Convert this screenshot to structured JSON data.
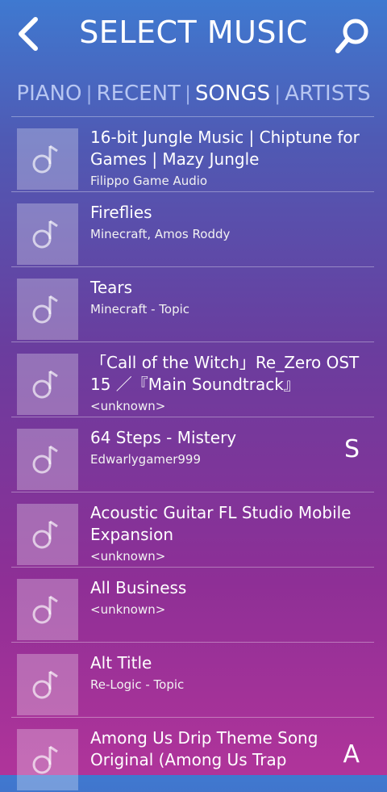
{
  "header": {
    "title": "SELECT MUSIC",
    "back_icon": "back-arrow-icon",
    "search_icon": "search-icon"
  },
  "tabs": [
    {
      "label": "PIANO",
      "active": false
    },
    {
      "label": "RECENT",
      "active": false
    },
    {
      "label": "SONGS",
      "active": true
    },
    {
      "label": "ARTISTS",
      "active": false
    }
  ],
  "songs": [
    {
      "title": "16-bit Jungle Music | Chiptune for Games | Mazy Jungle",
      "artist": "Filippo Game Audio"
    },
    {
      "title": "Fireflies",
      "artist": "Minecraft, Amos Roddy"
    },
    {
      "title": "Tears",
      "artist": "Minecraft - Topic"
    },
    {
      "title": "「Call of the Witch」Re_Zero OST 15 ／『Main Soundtrack』",
      "artist": "<unknown>"
    },
    {
      "title": "64 Steps - Mistery",
      "artist": "Edwarlygamer999"
    },
    {
      "title": "Acoustic Guitar FL Studio Mobile Expansion",
      "artist": "<unknown>"
    },
    {
      "title": "All Business",
      "artist": "<unknown>"
    },
    {
      "title": "Alt Title",
      "artist": "Re-Logic - Topic"
    },
    {
      "title": "Among Us Drip Theme Song Original (Among Us Trap",
      "artist": ""
    }
  ],
  "index_letters": [
    "S",
    "A"
  ]
}
